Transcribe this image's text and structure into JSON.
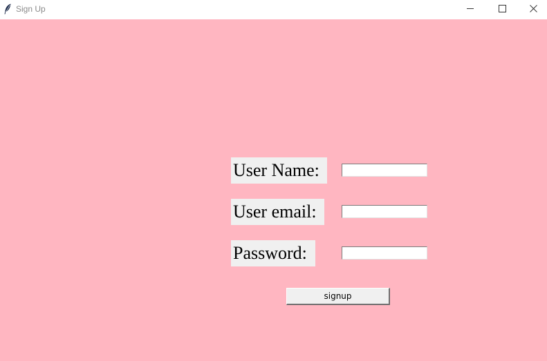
{
  "window": {
    "title": "Sign Up",
    "app_icon": "feather-icon",
    "controls": {
      "minimize": "minimize-icon",
      "maximize": "maximize-icon",
      "close": "close-icon"
    }
  },
  "colors": {
    "background": "#ffb6c1",
    "label_background": "#f0f0f0",
    "titlebar": "#ffffff"
  },
  "form": {
    "username_label": "User Name:",
    "email_label": "User email:",
    "password_label": "Password:",
    "username_value": "",
    "email_value": "",
    "password_value": "",
    "submit_label": "signup"
  }
}
